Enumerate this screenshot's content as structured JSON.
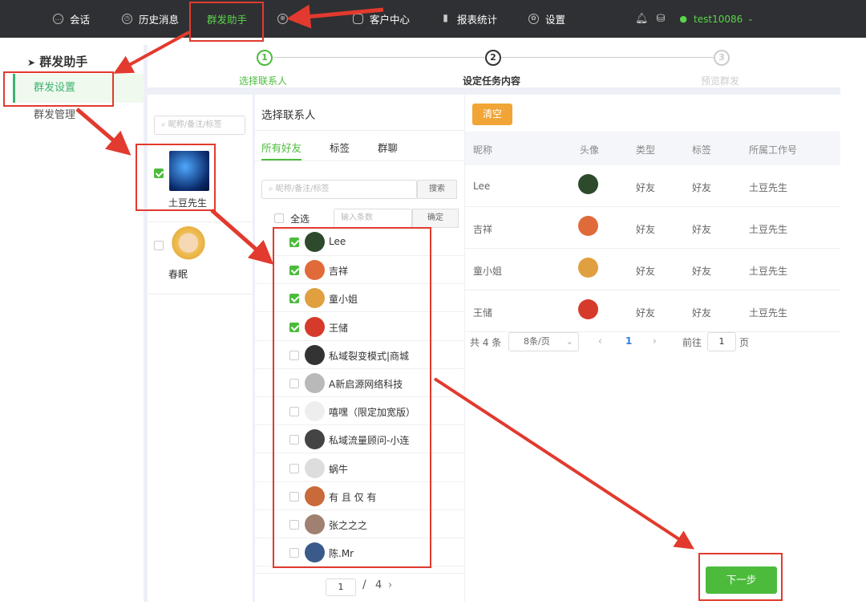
{
  "topnav": {
    "items": [
      {
        "label": "会话",
        "icon": "chat-icon"
      },
      {
        "label": "历史消息",
        "icon": "clock-icon"
      },
      {
        "label": "群发助手",
        "icon": ""
      },
      {
        "label": "",
        "icon": "globe-icon"
      },
      {
        "label": "客户中心",
        "icon": "user-icon"
      },
      {
        "label": "报表统计",
        "icon": "bar-chart-icon"
      },
      {
        "label": "设置",
        "icon": "gear-icon"
      }
    ],
    "username": "test10086"
  },
  "sidebar": {
    "title": "群发助手",
    "items": [
      {
        "label": "群发设置"
      },
      {
        "label": "群发管理"
      }
    ]
  },
  "steps": [
    {
      "num": "1",
      "label": "选择联系人"
    },
    {
      "num": "2",
      "label": "设定任务内容"
    },
    {
      "num": "3",
      "label": "预览群发"
    }
  ],
  "accounts": {
    "search_placeholder": "昵称/备注/标签",
    "items": [
      {
        "name": "土豆先生",
        "checked": true
      },
      {
        "name": "春眠",
        "checked": false
      }
    ]
  },
  "contacts_panel": {
    "title": "选择联系人",
    "tabs": [
      "所有好友",
      "标签",
      "群聊"
    ],
    "search_placeholder": "昵称/备注/标签",
    "search_button": "搜索",
    "select_all": "全选",
    "count_placeholder": "输入条数",
    "confirm_button": "确定",
    "contacts": [
      {
        "name": "Lee",
        "checked": true
      },
      {
        "name": "吉祥",
        "checked": true
      },
      {
        "name": "童小姐",
        "checked": true
      },
      {
        "name": "王储",
        "checked": true
      },
      {
        "name": "私域裂变模式|商城",
        "checked": false
      },
      {
        "name": "A新启源网络科技",
        "checked": false
      },
      {
        "name": "嘻嘿（限定加宽版）",
        "checked": false
      },
      {
        "name": "私域流量顾问-小连",
        "checked": false
      },
      {
        "name": "蜗牛",
        "checked": false
      },
      {
        "name": "有 且 仅 有",
        "checked": false
      },
      {
        "name": "张之之之",
        "checked": false
      },
      {
        "name": "陈.Mr",
        "checked": false
      }
    ],
    "page_current": "1",
    "page_sep": "/",
    "page_total": "4"
  },
  "selected_table": {
    "clear_button": "清空",
    "headers": [
      "昵称",
      "头像",
      "类型",
      "标签",
      "所属工作号"
    ],
    "rows": [
      {
        "nickname": "Lee",
        "type": "好友",
        "tag": "好友",
        "account": "土豆先生"
      },
      {
        "nickname": "吉祥",
        "type": "好友",
        "tag": "好友",
        "account": "土豆先生"
      },
      {
        "nickname": "童小姐",
        "type": "好友",
        "tag": "好友",
        "account": "土豆先生"
      },
      {
        "nickname": "王储",
        "type": "好友",
        "tag": "好友",
        "account": "土豆先生"
      }
    ],
    "pagination": {
      "total": "共 4 条",
      "page_size": "8条/页",
      "current": "1",
      "goto_label": "前往",
      "goto_value": "1",
      "page_unit": "页"
    }
  },
  "next_button": "下一步",
  "colors": {
    "accent": "#4cbb3c",
    "annotation": "#e23a2e",
    "topbar": "#2f3033",
    "clear": "#f0a536"
  }
}
